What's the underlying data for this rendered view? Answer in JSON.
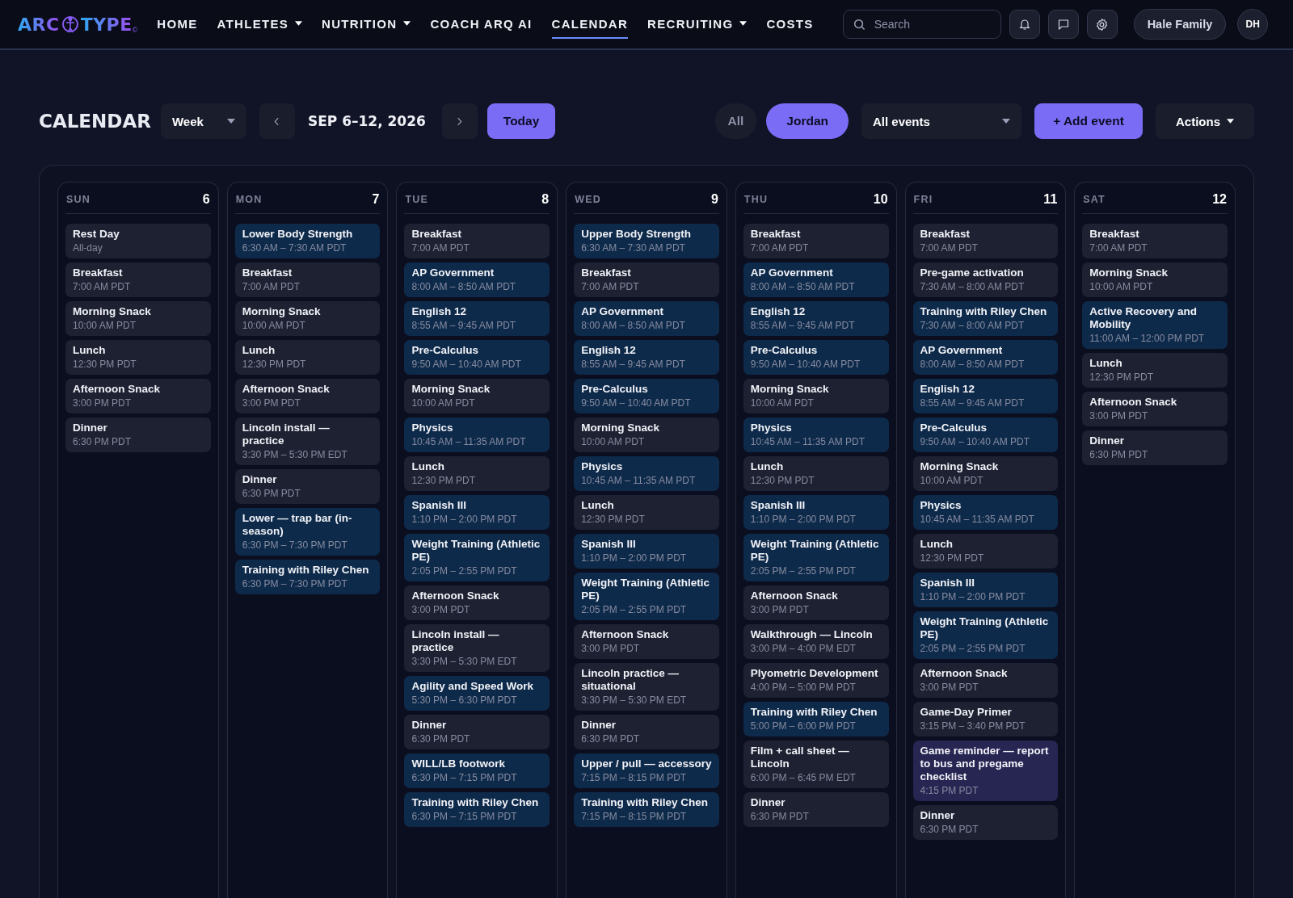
{
  "logo": {
    "left": "ARC",
    "right": "TYPE",
    "mark": "©"
  },
  "nav": [
    {
      "label": "HOME",
      "dropdown": false,
      "selected": false
    },
    {
      "label": "ATHLETES",
      "dropdown": true,
      "selected": false
    },
    {
      "label": "NUTRITION",
      "dropdown": true,
      "selected": false
    },
    {
      "label": "COACH ARQ AI",
      "dropdown": false,
      "selected": false
    },
    {
      "label": "CALENDAR",
      "dropdown": false,
      "selected": true
    },
    {
      "label": "RECRUITING",
      "dropdown": true,
      "selected": false
    },
    {
      "label": "COSTS",
      "dropdown": false,
      "selected": false
    }
  ],
  "search": {
    "placeholder": "Search"
  },
  "account": {
    "family": "Hale Family",
    "initials": "DH"
  },
  "toolbar": {
    "title": "CALENDAR",
    "view": "Week",
    "range": "SEP 6–12, 2026",
    "today": "Today",
    "people": [
      {
        "label": "All",
        "selected": false
      },
      {
        "label": "Jordan",
        "selected": true
      }
    ],
    "filter": "All events",
    "add": "+ Add event",
    "actions": "Actions"
  },
  "days": [
    {
      "name": "SUN",
      "date": "6",
      "events": [
        {
          "title": "Rest Day",
          "time": "All-day",
          "kind": "default"
        },
        {
          "title": "Breakfast",
          "time": "7:00 AM PDT",
          "kind": "default"
        },
        {
          "title": "Morning Snack",
          "time": "10:00 AM PDT",
          "kind": "default"
        },
        {
          "title": "Lunch",
          "time": "12:30 PM PDT",
          "kind": "default"
        },
        {
          "title": "Afternoon Snack",
          "time": "3:00 PM PDT",
          "kind": "default"
        },
        {
          "title": "Dinner",
          "time": "6:30 PM PDT",
          "kind": "default"
        }
      ]
    },
    {
      "name": "MON",
      "date": "7",
      "events": [
        {
          "title": "Lower Body Strength",
          "time": "6:30 AM – 7:30 AM PDT",
          "kind": "training"
        },
        {
          "title": "Breakfast",
          "time": "7:00 AM PDT",
          "kind": "default"
        },
        {
          "title": "Morning Snack",
          "time": "10:00 AM PDT",
          "kind": "default"
        },
        {
          "title": "Lunch",
          "time": "12:30 PM PDT",
          "kind": "default"
        },
        {
          "title": "Afternoon Snack",
          "time": "3:00 PM PDT",
          "kind": "default"
        },
        {
          "title": "Lincoln install — practice",
          "time": "3:30 PM – 5:30 PM EDT",
          "kind": "default"
        },
        {
          "title": "Dinner",
          "time": "6:30 PM PDT",
          "kind": "default"
        },
        {
          "title": "Lower — trap bar (in-season)",
          "time": "6:30 PM – 7:30 PM PDT",
          "kind": "training"
        },
        {
          "title": "Training with Riley Chen",
          "time": "6:30 PM – 7:30 PM PDT",
          "kind": "training"
        }
      ]
    },
    {
      "name": "TUE",
      "date": "8",
      "events": [
        {
          "title": "Breakfast",
          "time": "7:00 AM PDT",
          "kind": "default"
        },
        {
          "title": "AP Government",
          "time": "8:00 AM – 8:50 AM PDT",
          "kind": "training"
        },
        {
          "title": "English 12",
          "time": "8:55 AM – 9:45 AM PDT",
          "kind": "training"
        },
        {
          "title": "Pre-Calculus",
          "time": "9:50 AM – 10:40 AM PDT",
          "kind": "training"
        },
        {
          "title": "Morning Snack",
          "time": "10:00 AM PDT",
          "kind": "default"
        },
        {
          "title": "Physics",
          "time": "10:45 AM – 11:35 AM PDT",
          "kind": "training"
        },
        {
          "title": "Lunch",
          "time": "12:30 PM PDT",
          "kind": "default"
        },
        {
          "title": "Spanish III",
          "time": "1:10 PM – 2:00 PM PDT",
          "kind": "training"
        },
        {
          "title": "Weight Training (Athletic PE)",
          "time": "2:05 PM – 2:55 PM PDT",
          "kind": "training"
        },
        {
          "title": "Afternoon Snack",
          "time": "3:00 PM PDT",
          "kind": "default"
        },
        {
          "title": "Lincoln install — practice",
          "time": "3:30 PM – 5:30 PM EDT",
          "kind": "default"
        },
        {
          "title": "Agility and Speed Work",
          "time": "5:30 PM – 6:30 PM PDT",
          "kind": "training"
        },
        {
          "title": "Dinner",
          "time": "6:30 PM PDT",
          "kind": "default"
        },
        {
          "title": "WILL/LB footwork",
          "time": "6:30 PM – 7:15 PM PDT",
          "kind": "training"
        },
        {
          "title": "Training with Riley Chen",
          "time": "6:30 PM – 7:15 PM PDT",
          "kind": "training"
        }
      ]
    },
    {
      "name": "WED",
      "date": "9",
      "events": [
        {
          "title": "Upper Body Strength",
          "time": "6:30 AM – 7:30 AM PDT",
          "kind": "training"
        },
        {
          "title": "Breakfast",
          "time": "7:00 AM PDT",
          "kind": "default"
        },
        {
          "title": "AP Government",
          "time": "8:00 AM – 8:50 AM PDT",
          "kind": "training"
        },
        {
          "title": "English 12",
          "time": "8:55 AM – 9:45 AM PDT",
          "kind": "training"
        },
        {
          "title": "Pre-Calculus",
          "time": "9:50 AM – 10:40 AM PDT",
          "kind": "training"
        },
        {
          "title": "Morning Snack",
          "time": "10:00 AM PDT",
          "kind": "default"
        },
        {
          "title": "Physics",
          "time": "10:45 AM – 11:35 AM PDT",
          "kind": "training"
        },
        {
          "title": "Lunch",
          "time": "12:30 PM PDT",
          "kind": "default"
        },
        {
          "title": "Spanish III",
          "time": "1:10 PM – 2:00 PM PDT",
          "kind": "training"
        },
        {
          "title": "Weight Training (Athletic PE)",
          "time": "2:05 PM – 2:55 PM PDT",
          "kind": "training"
        },
        {
          "title": "Afternoon Snack",
          "time": "3:00 PM PDT",
          "kind": "default"
        },
        {
          "title": "Lincoln practice — situational",
          "time": "3:30 PM – 5:30 PM EDT",
          "kind": "default"
        },
        {
          "title": "Dinner",
          "time": "6:30 PM PDT",
          "kind": "default"
        },
        {
          "title": "Upper / pull — accessory",
          "time": "7:15 PM – 8:15 PM PDT",
          "kind": "training"
        },
        {
          "title": "Training with Riley Chen",
          "time": "7:15 PM – 8:15 PM PDT",
          "kind": "training"
        }
      ]
    },
    {
      "name": "THU",
      "date": "10",
      "events": [
        {
          "title": "Breakfast",
          "time": "7:00 AM PDT",
          "kind": "default"
        },
        {
          "title": "AP Government",
          "time": "8:00 AM – 8:50 AM PDT",
          "kind": "training"
        },
        {
          "title": "English 12",
          "time": "8:55 AM – 9:45 AM PDT",
          "kind": "training"
        },
        {
          "title": "Pre-Calculus",
          "time": "9:50 AM – 10:40 AM PDT",
          "kind": "training"
        },
        {
          "title": "Morning Snack",
          "time": "10:00 AM PDT",
          "kind": "default"
        },
        {
          "title": "Physics",
          "time": "10:45 AM – 11:35 AM PDT",
          "kind": "training"
        },
        {
          "title": "Lunch",
          "time": "12:30 PM PDT",
          "kind": "default"
        },
        {
          "title": "Spanish III",
          "time": "1:10 PM – 2:00 PM PDT",
          "kind": "training"
        },
        {
          "title": "Weight Training (Athletic PE)",
          "time": "2:05 PM – 2:55 PM PDT",
          "kind": "training"
        },
        {
          "title": "Afternoon Snack",
          "time": "3:00 PM PDT",
          "kind": "default"
        },
        {
          "title": "Walkthrough — Lincoln",
          "time": "3:00 PM – 4:00 PM EDT",
          "kind": "default"
        },
        {
          "title": "Plyometric Development",
          "time": "4:00 PM – 5:00 PM PDT",
          "kind": "default"
        },
        {
          "title": "Training with Riley Chen",
          "time": "5:00 PM – 6:00 PM PDT",
          "kind": "training"
        },
        {
          "title": "Film + call sheet — Lincoln",
          "time": "6:00 PM – 6:45 PM EDT",
          "kind": "default"
        },
        {
          "title": "Dinner",
          "time": "6:30 PM PDT",
          "kind": "default"
        }
      ]
    },
    {
      "name": "FRI",
      "date": "11",
      "events": [
        {
          "title": "Breakfast",
          "time": "7:00 AM PDT",
          "kind": "default"
        },
        {
          "title": "Pre-game activation",
          "time": "7:30 AM – 8:00 AM PDT",
          "kind": "default"
        },
        {
          "title": "Training with Riley Chen",
          "time": "7:30 AM – 8:00 AM PDT",
          "kind": "training"
        },
        {
          "title": "AP Government",
          "time": "8:00 AM – 8:50 AM PDT",
          "kind": "training"
        },
        {
          "title": "English 12",
          "time": "8:55 AM – 9:45 AM PDT",
          "kind": "training"
        },
        {
          "title": "Pre-Calculus",
          "time": "9:50 AM – 10:40 AM PDT",
          "kind": "training"
        },
        {
          "title": "Morning Snack",
          "time": "10:00 AM PDT",
          "kind": "default"
        },
        {
          "title": "Physics",
          "time": "10:45 AM – 11:35 AM PDT",
          "kind": "training"
        },
        {
          "title": "Lunch",
          "time": "12:30 PM PDT",
          "kind": "default"
        },
        {
          "title": "Spanish III",
          "time": "1:10 PM – 2:00 PM PDT",
          "kind": "training"
        },
        {
          "title": "Weight Training (Athletic PE)",
          "time": "2:05 PM – 2:55 PM PDT",
          "kind": "training"
        },
        {
          "title": "Afternoon Snack",
          "time": "3:00 PM PDT",
          "kind": "default"
        },
        {
          "title": "Game-Day Primer",
          "time": "3:15 PM – 3:40 PM PDT",
          "kind": "default"
        },
        {
          "title": "Game reminder — report to bus and pregame checklist",
          "time": "4:15 PM PDT",
          "kind": "reminder"
        },
        {
          "title": "Dinner",
          "time": "6:30 PM PDT",
          "kind": "default"
        }
      ]
    },
    {
      "name": "SAT",
      "date": "12",
      "events": [
        {
          "title": "Breakfast",
          "time": "7:00 AM PDT",
          "kind": "default"
        },
        {
          "title": "Morning Snack",
          "time": "10:00 AM PDT",
          "kind": "default"
        },
        {
          "title": "Active Recovery and Mobility",
          "time": "11:00 AM – 12:00 PM PDT",
          "kind": "training"
        },
        {
          "title": "Lunch",
          "time": "12:30 PM PDT",
          "kind": "default"
        },
        {
          "title": "Afternoon Snack",
          "time": "3:00 PM PDT",
          "kind": "default"
        },
        {
          "title": "Dinner",
          "time": "6:30 PM PDT",
          "kind": "default"
        }
      ]
    }
  ]
}
